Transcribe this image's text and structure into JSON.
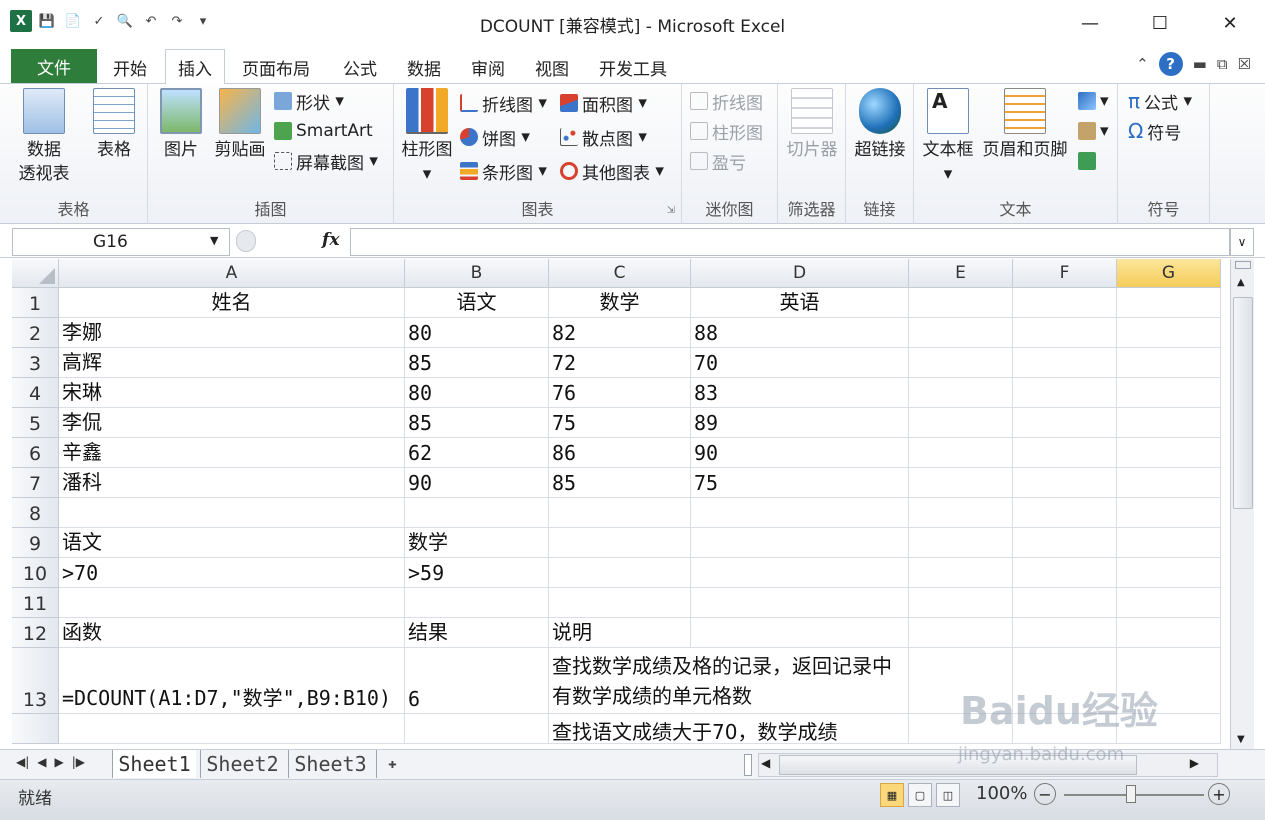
{
  "window": {
    "title": "DCOUNT  [兼容模式] - Microsoft Excel"
  },
  "tabs": {
    "file": "文件",
    "items": [
      "开始",
      "插入",
      "页面布局",
      "公式",
      "数据",
      "审阅",
      "视图",
      "开发工具"
    ],
    "active": "插入"
  },
  "ribbon": {
    "groups": {
      "tables": {
        "label": "表格",
        "pivot_line1": "数据",
        "pivot_line2": "透视表",
        "table": "表格"
      },
      "illustrations": {
        "label": "插图",
        "picture": "图片",
        "clipart": "剪贴画",
        "shapes": "形状",
        "smartart": "SmartArt",
        "screenshot": "屏幕截图"
      },
      "charts": {
        "label": "图表",
        "column": "柱形图",
        "line": "折线图",
        "pie": "饼图",
        "bar": "条形图",
        "area": "面积图",
        "scatter": "散点图",
        "other": "其他图表"
      },
      "sparklines": {
        "label": "迷你图",
        "line": "折线图",
        "column": "柱形图",
        "winloss": "盈亏"
      },
      "filter": {
        "label": "筛选器",
        "slicer": "切片器"
      },
      "links": {
        "label": "链接",
        "hyperlink": "超链接"
      },
      "text": {
        "label": "文本",
        "textbox": "文本框",
        "headerfooter": "页眉和页脚"
      },
      "symbols": {
        "label": "符号",
        "equation": "公式",
        "symbol": "符号"
      }
    }
  },
  "formula_bar": {
    "name_box": "G16",
    "fx": "fx",
    "formula": ""
  },
  "columns": [
    "A",
    "B",
    "C",
    "D",
    "E",
    "F",
    "G"
  ],
  "selected_column": "G",
  "rows": [
    {
      "n": "1",
      "a": "姓名",
      "b": "语文",
      "c": "数学",
      "d": "英语"
    },
    {
      "n": "2",
      "a": "李娜",
      "b": "80",
      "c": "82",
      "d": "88"
    },
    {
      "n": "3",
      "a": "高辉",
      "b": "85",
      "c": "72",
      "d": "70"
    },
    {
      "n": "4",
      "a": "宋琳",
      "b": "80",
      "c": "76",
      "d": "83"
    },
    {
      "n": "5",
      "a": "李侃",
      "b": "85",
      "c": "75",
      "d": "89"
    },
    {
      "n": "6",
      "a": "辛鑫",
      "b": "62",
      "c": "86",
      "d": "90"
    },
    {
      "n": "7",
      "a": "潘科",
      "b": "90",
      "c": "85",
      "d": "75"
    },
    {
      "n": "8",
      "a": "",
      "b": "",
      "c": "",
      "d": ""
    },
    {
      "n": "9",
      "a": "语文",
      "b": "数学",
      "c": "",
      "d": ""
    },
    {
      "n": "10",
      "a": ">70",
      "b": ">59",
      "c": "",
      "d": ""
    },
    {
      "n": "11",
      "a": "",
      "b": "",
      "c": "",
      "d": ""
    },
    {
      "n": "12",
      "a": "函数",
      "b": "结果",
      "c": "说明",
      "d": ""
    },
    {
      "n": "13",
      "a": "=DCOUNT(A1:D7,\"数学\",B9:B10)",
      "b": "6",
      "c": "查找数学成绩及格的记录，返回记录中有数学成绩的单元格数",
      "d": ""
    },
    {
      "n": "",
      "a": "",
      "b": "",
      "c": "查找语文成绩大于70，数学成绩",
      "d": ""
    }
  ],
  "sheets": [
    "Sheet1",
    "Sheet2",
    "Sheet3"
  ],
  "active_sheet": "Sheet1",
  "status": {
    "text": "就绪",
    "zoom": "100%"
  },
  "watermark": {
    "brand": "Baidu经验",
    "url": "jingyan.baidu.com"
  },
  "colors": {
    "file_tab": "#2e7d3a",
    "selected_header": "#f5cc5a",
    "excel_green": "#1e7145"
  }
}
